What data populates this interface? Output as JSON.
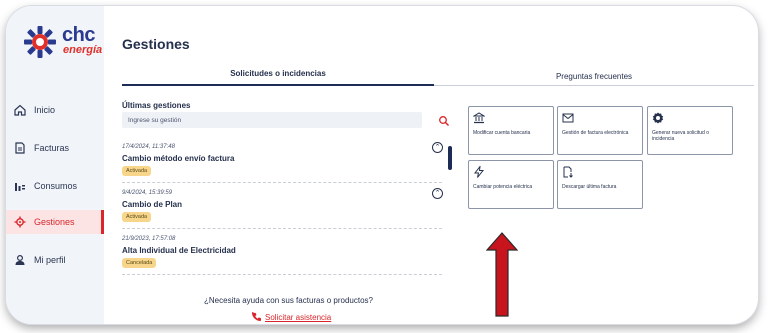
{
  "brand": {
    "name": "chc",
    "sub": "energía"
  },
  "nav": [
    {
      "label": "Inicio",
      "icon": "home-icon",
      "active": false
    },
    {
      "label": "Facturas",
      "icon": "invoice-icon",
      "active": false
    },
    {
      "label": "Consumos",
      "icon": "bar-chart-icon",
      "active": false
    },
    {
      "label": "Gestiones",
      "icon": "gear-icon",
      "active": true
    },
    {
      "label": "Mi perfil",
      "icon": "user-icon",
      "active": false
    }
  ],
  "page_title": "Gestiones",
  "tabs": [
    {
      "label": "Solicitudes o incidencias",
      "active": true
    },
    {
      "label": "Preguntas frecuentes",
      "active": false
    }
  ],
  "recent": {
    "title": "Últimas gestiones",
    "search_placeholder": "Ingrese su gestión",
    "items": [
      {
        "date": "17/4/2024, 11:37:48",
        "title": "Cambio método envío factura",
        "status": "Activada"
      },
      {
        "date": "9/4/2024, 15:39:59",
        "title": "Cambio de Plan",
        "status": "Activada"
      },
      {
        "date": "21/9/2023, 17:57:08",
        "title": "Alta Individual de Electricidad",
        "status": "Cancelada"
      }
    ]
  },
  "help": {
    "question": "¿Necesita ayuda con sus facturas o productos?",
    "link": "Solicitar asistencia"
  },
  "actions": [
    {
      "label": "Modificar cuenta bancaria",
      "icon": "bank-icon"
    },
    {
      "label": "Gestión de factura electrónica",
      "icon": "email-icon"
    },
    {
      "label": "Generar nueva solicitud o incidencia",
      "icon": "gear-badge-icon"
    },
    {
      "label": "Cambiar potencia eléctrica",
      "icon": "lightning-icon"
    },
    {
      "label": "Descargar última factura",
      "icon": "document-download-icon"
    }
  ],
  "colors": {
    "accent": "#d8262c",
    "navy": "#1d2b57",
    "badge": "#f7d68b"
  }
}
